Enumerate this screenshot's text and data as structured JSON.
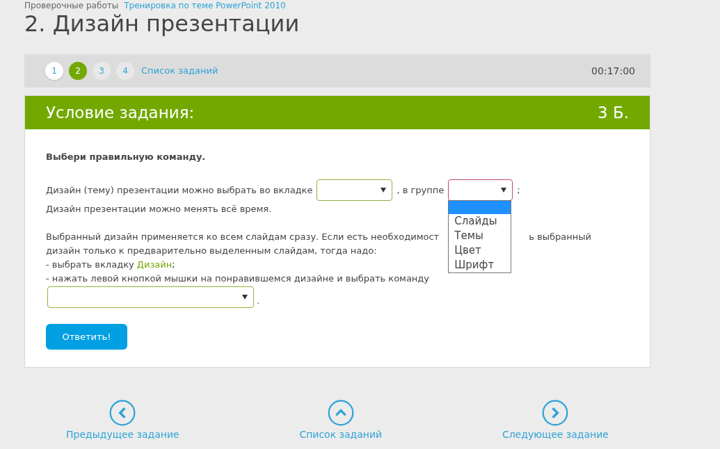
{
  "breadcrumbs": [
    "Проверочные работы",
    "Тренировка по теме PowerPoint 2010"
  ],
  "title": "2. Дизайн презентации",
  "task_nav": {
    "steps": [
      {
        "label": "1",
        "selected": false,
        "done": true
      },
      {
        "label": "2",
        "selected": true,
        "done": false
      },
      {
        "label": "3",
        "selected": false,
        "done": false
      },
      {
        "label": "4",
        "selected": false,
        "done": false
      }
    ],
    "list_link": "Список заданий",
    "timer": "00:17:00"
  },
  "task": {
    "header": "Условие задания:",
    "points": "3 Б.",
    "instruction": "Выбери правильную команду.",
    "line1_before": "Дизайн (тему) презентации можно выбрать во вкладке",
    "select_tab": {
      "focused": false
    },
    "line1_middle": ", в группе",
    "select_group": {
      "focused": true,
      "open": true,
      "options": [
        "Слайды",
        "Темы",
        "Цвет",
        "Шрифт"
      ]
    },
    "line1_after": ";",
    "line2": "Дизайн презентации можно менять всё время.",
    "paragraph_line1_left": "Выбранный дизайн применяется ко всем слайдам сразу. Если есть необходимост",
    "paragraph_line1_right": "ь выбранный",
    "paragraph_line2": "дизайн только к предварительно выделенным слайдам, тогда надо:",
    "step1_before": "- выбрать вкладку",
    "step1_link": "Дизайн",
    "step1_after": ";",
    "step2": "- нажать левой кнопкой мышки на понравившемся дизайне и выбрать команду",
    "select_command": {
      "focused": false
    },
    "step2_after": ".",
    "answer_button": "Ответить!"
  },
  "footer_nav": [
    {
      "kind": "prev",
      "label": "Предыдущее задание"
    },
    {
      "kind": "list",
      "label": "Список заданий"
    },
    {
      "kind": "next",
      "label": "Следующее задание"
    }
  ]
}
